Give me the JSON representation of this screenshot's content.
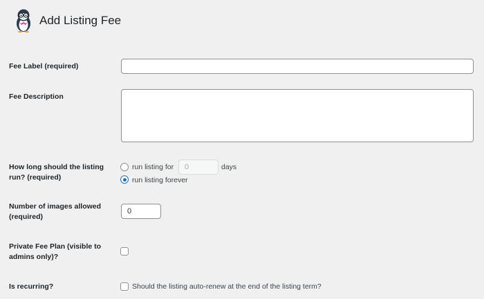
{
  "header": {
    "title": "Add Listing Fee",
    "logo_icon": "penguin-mascot-icon"
  },
  "fields": {
    "label": {
      "label": "Fee Label (required)",
      "value": ""
    },
    "description": {
      "label": "Fee Description",
      "value": ""
    },
    "duration": {
      "label_line1": "How long should the listing",
      "label_line2": "run? (required)",
      "option_days_prefix": "run listing for",
      "days_value": "0",
      "option_days_suffix": "days",
      "option_forever": "run listing forever",
      "selected": "forever"
    },
    "images": {
      "label_line1": "Number of images allowed",
      "label_line2": "(required)",
      "value": "0"
    },
    "private": {
      "label_line1": "Private Fee Plan (visible to",
      "label_line2": "admins only)?",
      "checked": false
    },
    "recurring": {
      "label": "Is recurring?",
      "option_text": "Should the listing auto-renew at the end of the listing term?",
      "checked": false
    }
  },
  "colors": {
    "background": "#f0f0f1",
    "accent": "#2271b1",
    "input_border": "#8c8f94"
  }
}
